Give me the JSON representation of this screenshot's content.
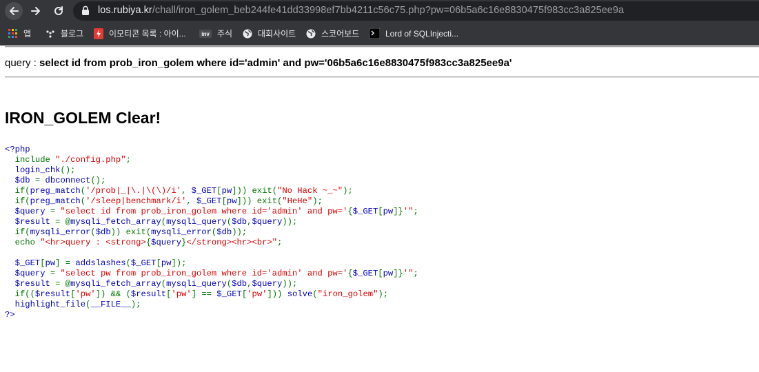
{
  "browser": {
    "url_host": "los.rubiya.kr",
    "url_path": "/chall/iron_golem_beb244fe41dd33998ef7bb4211c56c75.php?pw=06b5a6c16e8830475f983cc3a825ee9a",
    "icons": {
      "back": "back-arrow-icon",
      "forward": "forward-arrow-icon",
      "reload": "reload-icon",
      "lock": "lock-icon"
    }
  },
  "bookmarks": [
    {
      "label": "앱",
      "icon": "apps-grid-icon"
    },
    {
      "label": "블로그",
      "icon": "blog-icon"
    },
    {
      "label": "이모티콘 목록 : 아이...",
      "icon": "emoticon-icon"
    },
    {
      "label": "주식",
      "icon": "stock-icon"
    },
    {
      "label": "대회사이트",
      "icon": "globe-icon"
    },
    {
      "label": "스코어보드",
      "icon": "globe-icon"
    },
    {
      "label": "Lord of SQLInjecti...",
      "icon": "terminal-icon"
    }
  ],
  "page": {
    "query_prefix": "query : ",
    "query_text": "select id from prob_iron_golem where id='admin' and pw='06b5a6c16e8830475f983cc3a825ee9a'",
    "clear_heading": "IRON_GOLEM Clear!"
  },
  "source_code": [
    [
      [
        "v",
        "<?php"
      ]
    ],
    [
      [
        "v",
        "  "
      ],
      [
        "k",
        "include "
      ],
      [
        "s",
        "\"./config.php\""
      ],
      [
        "k",
        ";"
      ]
    ],
    [
      [
        "v",
        "  login_chk"
      ],
      [
        "k",
        "();"
      ]
    ],
    [
      [
        "v",
        "  $db "
      ],
      [
        "k",
        "= "
      ],
      [
        "v",
        "dbconnect"
      ],
      [
        "k",
        "();"
      ]
    ],
    [
      [
        "v",
        "  "
      ],
      [
        "k",
        "if("
      ],
      [
        "v",
        "preg_match"
      ],
      [
        "k",
        "("
      ],
      [
        "s",
        "'/prob|_|\\.|\\(\\)/i'"
      ],
      [
        "k",
        ", "
      ],
      [
        "v",
        "$_GET"
      ],
      [
        "k",
        "["
      ],
      [
        "v",
        "pw"
      ],
      [
        "k",
        "])) exit("
      ],
      [
        "s",
        "\"No Hack ~_~\""
      ],
      [
        "k",
        ");"
      ]
    ],
    [
      [
        "v",
        "  "
      ],
      [
        "k",
        "if("
      ],
      [
        "v",
        "preg_match"
      ],
      [
        "k",
        "("
      ],
      [
        "s",
        "'/sleep|benchmark/i'"
      ],
      [
        "k",
        ", "
      ],
      [
        "v",
        "$_GET"
      ],
      [
        "k",
        "["
      ],
      [
        "v",
        "pw"
      ],
      [
        "k",
        "])) exit("
      ],
      [
        "s",
        "\"HeHe\""
      ],
      [
        "k",
        ");"
      ]
    ],
    [
      [
        "v",
        "  $query "
      ],
      [
        "k",
        "= "
      ],
      [
        "s",
        "\"select id from prob_iron_golem where id='admin' and pw='"
      ],
      [
        "k",
        "{"
      ],
      [
        "v",
        "$_GET"
      ],
      [
        "k",
        "["
      ],
      [
        "v",
        "pw"
      ],
      [
        "k",
        "]}"
      ],
      [
        "s",
        "'\""
      ],
      [
        "k",
        ";"
      ]
    ],
    [
      [
        "v",
        "  $result "
      ],
      [
        "k",
        "= @"
      ],
      [
        "v",
        "mysqli_fetch_array"
      ],
      [
        "k",
        "("
      ],
      [
        "v",
        "mysqli_query"
      ],
      [
        "k",
        "("
      ],
      [
        "v",
        "$db"
      ],
      [
        "k",
        ","
      ],
      [
        "v",
        "$query"
      ],
      [
        "k",
        "));"
      ]
    ],
    [
      [
        "v",
        "  "
      ],
      [
        "k",
        "if("
      ],
      [
        "v",
        "mysqli_error"
      ],
      [
        "k",
        "("
      ],
      [
        "v",
        "$db"
      ],
      [
        "k",
        ")) exit("
      ],
      [
        "v",
        "mysqli_error"
      ],
      [
        "k",
        "("
      ],
      [
        "v",
        "$db"
      ],
      [
        "k",
        "));"
      ]
    ],
    [
      [
        "v",
        "  "
      ],
      [
        "k",
        "echo "
      ],
      [
        "s",
        "\"<hr>query : <strong>"
      ],
      [
        "k",
        "{"
      ],
      [
        "v",
        "$query"
      ],
      [
        "k",
        "}"
      ],
      [
        "s",
        "</strong><hr><br>\""
      ],
      [
        "k",
        ";"
      ]
    ],
    [
      [
        "v",
        ""
      ]
    ],
    [
      [
        "v",
        "  $_GET"
      ],
      [
        "k",
        "["
      ],
      [
        "v",
        "pw"
      ],
      [
        "k",
        "] = "
      ],
      [
        "v",
        "addslashes"
      ],
      [
        "k",
        "("
      ],
      [
        "v",
        "$_GET"
      ],
      [
        "k",
        "["
      ],
      [
        "v",
        "pw"
      ],
      [
        "k",
        "]);"
      ]
    ],
    [
      [
        "v",
        "  $query "
      ],
      [
        "k",
        "= "
      ],
      [
        "s",
        "\"select pw from prob_iron_golem where id='admin' and pw='"
      ],
      [
        "k",
        "{"
      ],
      [
        "v",
        "$_GET"
      ],
      [
        "k",
        "["
      ],
      [
        "v",
        "pw"
      ],
      [
        "k",
        "]}"
      ],
      [
        "s",
        "'\""
      ],
      [
        "k",
        ";"
      ]
    ],
    [
      [
        "v",
        "  $result "
      ],
      [
        "k",
        "= @"
      ],
      [
        "v",
        "mysqli_fetch_array"
      ],
      [
        "k",
        "("
      ],
      [
        "v",
        "mysqli_query"
      ],
      [
        "k",
        "("
      ],
      [
        "v",
        "$db"
      ],
      [
        "k",
        ","
      ],
      [
        "v",
        "$query"
      ],
      [
        "k",
        "));"
      ]
    ],
    [
      [
        "v",
        "  "
      ],
      [
        "k",
        "if(("
      ],
      [
        "v",
        "$result"
      ],
      [
        "k",
        "["
      ],
      [
        "s",
        "'pw'"
      ],
      [
        "k",
        "]) && ("
      ],
      [
        "v",
        "$result"
      ],
      [
        "k",
        "["
      ],
      [
        "s",
        "'pw'"
      ],
      [
        "k",
        "] == "
      ],
      [
        "v",
        "$_GET"
      ],
      [
        "k",
        "["
      ],
      [
        "s",
        "'pw'"
      ],
      [
        "k",
        "])) "
      ],
      [
        "v",
        "solve"
      ],
      [
        "k",
        "("
      ],
      [
        "s",
        "\"iron_golem\""
      ],
      [
        "k",
        ");"
      ]
    ],
    [
      [
        "v",
        "  highlight_file"
      ],
      [
        "k",
        "("
      ],
      [
        "v",
        "__FILE__"
      ],
      [
        "k",
        ");"
      ]
    ],
    [
      [
        "v",
        "?>"
      ]
    ]
  ]
}
